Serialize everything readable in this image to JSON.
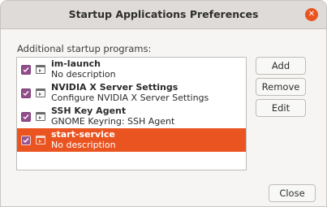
{
  "window": {
    "title": "Startup Applications Preferences",
    "close_icon": "close-icon"
  },
  "section_label": "Additional startup programs:",
  "programs": [
    {
      "name": "im-launch",
      "description": "No description",
      "enabled": true,
      "selected": false
    },
    {
      "name": "NVIDIA X Server Settings",
      "description": "Configure NVIDIA X Server Settings",
      "enabled": true,
      "selected": false
    },
    {
      "name": "SSH Key Agent",
      "description": "GNOME Keyring: SSH Agent",
      "enabled": true,
      "selected": false
    },
    {
      "name": "start-service",
      "description": "No description",
      "enabled": true,
      "selected": true
    }
  ],
  "buttons": {
    "add": "Add",
    "remove": "Remove",
    "edit": "Edit",
    "close": "Close"
  },
  "colors": {
    "accent": "#e95420",
    "checkbox": "#924d8b"
  }
}
